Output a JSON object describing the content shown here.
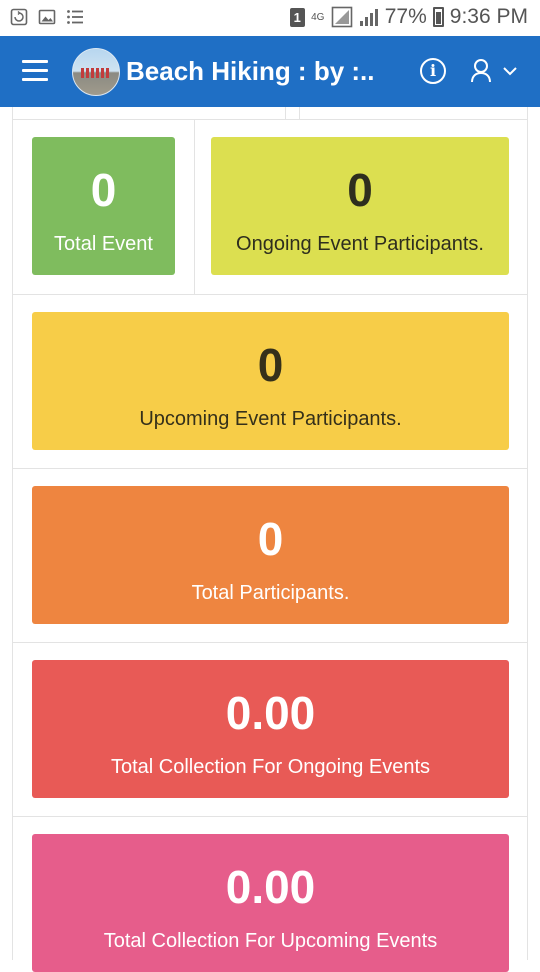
{
  "status_bar": {
    "sim_badge": "1",
    "network": "4G",
    "battery_percent": "77%",
    "time": "9:36 PM"
  },
  "app_bar": {
    "title": "Beach Hiking : by :..."
  },
  "stats": {
    "total_event": {
      "value": "0",
      "label": "Total Event"
    },
    "ongoing_participants": {
      "value": "0",
      "label": "Ongoing Event Participants."
    },
    "upcoming_participants": {
      "value": "0",
      "label": "Upcoming Event Participants."
    },
    "total_participants": {
      "value": "0",
      "label": "Total Participants."
    },
    "collection_ongoing": {
      "value": "0.00",
      "label": "Total Collection For Ongoing Events"
    },
    "collection_upcoming": {
      "value": "0.00",
      "label": "Total Collection For Upcoming Events"
    }
  },
  "colors": {
    "app_bar": "#1f6fc5",
    "green": "#7fbc5e",
    "lime": "#dcdf50",
    "yellow": "#f7cd48",
    "orange": "#ee8540",
    "red": "#e85a56",
    "pink": "#e65d8b"
  }
}
